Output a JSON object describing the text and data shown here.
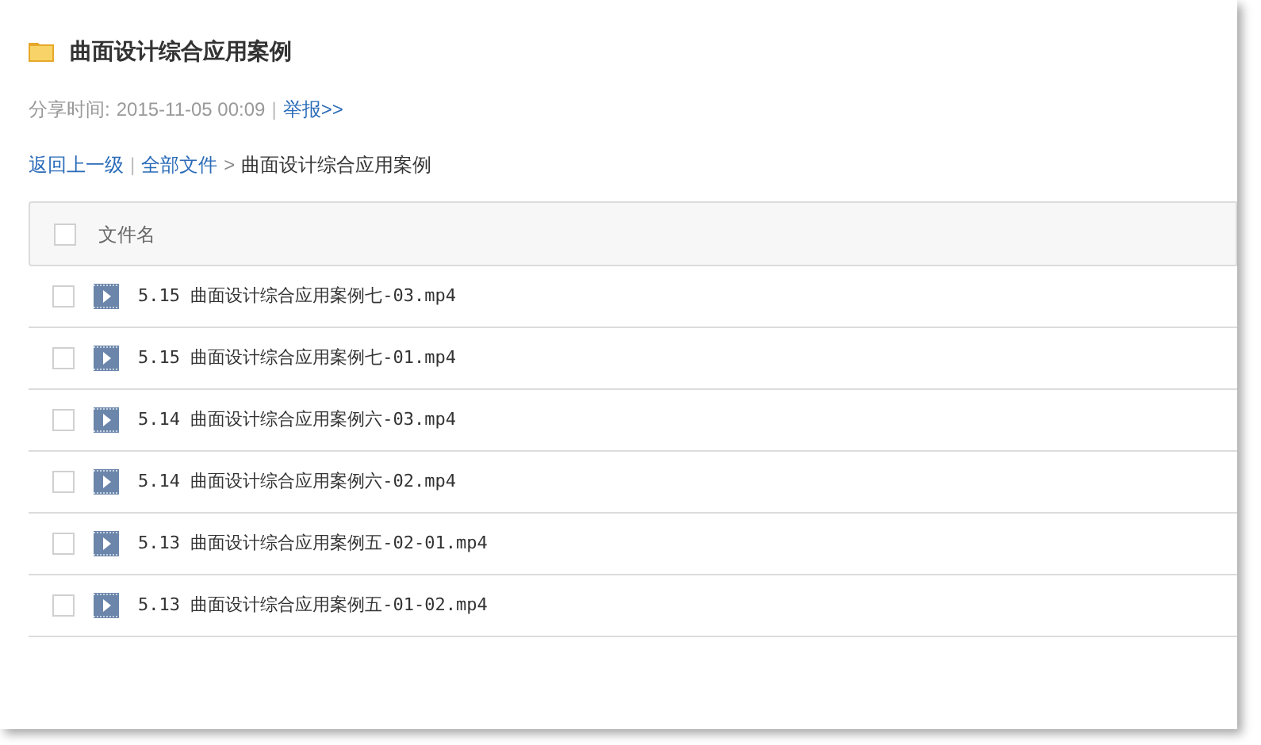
{
  "folder": {
    "title": "曲面设计综合应用案例"
  },
  "share": {
    "label": "分享时间:",
    "time": "2015-11-05 00:09",
    "separator": "|",
    "report_link": "举报>>"
  },
  "breadcrumb": {
    "back": "返回上一级",
    "separator": "|",
    "root": "全部文件",
    "arrow": ">",
    "current": "曲面设计综合应用案例"
  },
  "table": {
    "header": {
      "label": "文件名",
      "checked": false
    },
    "rows": [
      {
        "name": "5.15 曲面设计综合应用案例七-03.mp4",
        "checked": false
      },
      {
        "name": "5.15 曲面设计综合应用案例七-01.mp4",
        "checked": false
      },
      {
        "name": "5.14 曲面设计综合应用案例六-03.mp4",
        "checked": false
      },
      {
        "name": "5.14 曲面设计综合应用案例六-02.mp4",
        "checked": false
      },
      {
        "name": "5.13 曲面设计综合应用案例五-02-01.mp4",
        "checked": false
      },
      {
        "name": "5.13 曲面设计综合应用案例五-01-02.mp4",
        "checked": false
      }
    ]
  }
}
